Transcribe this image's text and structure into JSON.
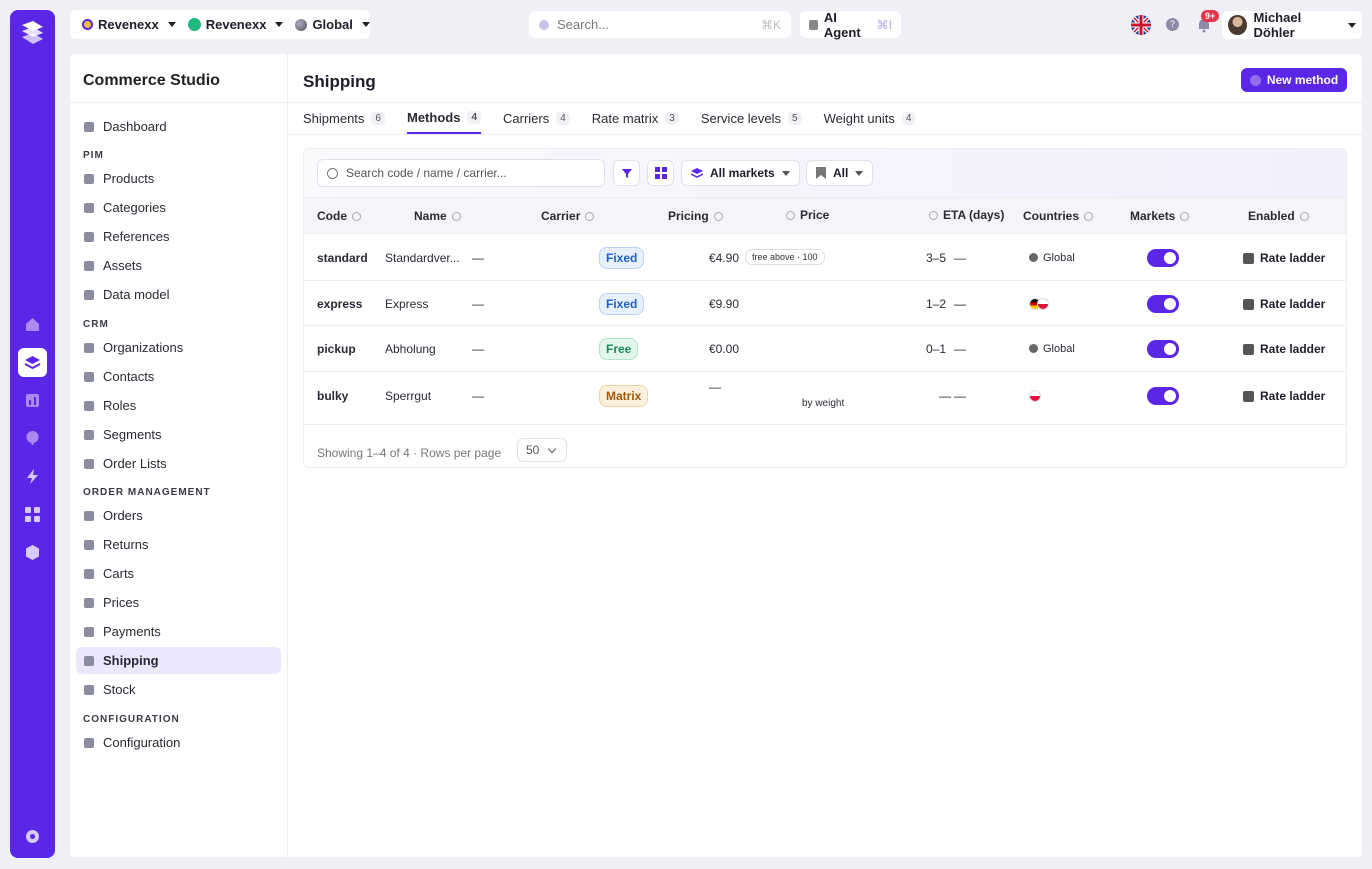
{
  "topbar": {
    "org1": "Revenexx",
    "org2": "Revenexx",
    "market": "Global",
    "search_placeholder": "Search...",
    "search_shortcut": "⌘K",
    "ai_label": "AI Agent",
    "ai_shortcut": "⌘I",
    "notifications": "9+",
    "user_name": "Michael Döhler"
  },
  "sidebar": {
    "title": "Commerce Studio",
    "top": [
      {
        "label": "Dashboard"
      }
    ],
    "sections": [
      {
        "title": "PIM",
        "items": [
          "Products",
          "Categories",
          "References",
          "Assets",
          "Data model"
        ]
      },
      {
        "title": "CRM",
        "items": [
          "Organizations",
          "Contacts",
          "Roles",
          "Segments",
          "Order Lists"
        ]
      },
      {
        "title": "ORDER MANAGEMENT",
        "items": [
          "Orders",
          "Returns",
          "Carts",
          "Prices",
          "Payments",
          "Shipping",
          "Stock"
        ]
      },
      {
        "title": "CONFIGURATION",
        "items": [
          "Configuration"
        ]
      }
    ],
    "active": "Shipping"
  },
  "page": {
    "title": "Shipping",
    "new_button": "New method",
    "tabs": [
      {
        "label": "Shipments",
        "count": "6"
      },
      {
        "label": "Methods",
        "count": "4"
      },
      {
        "label": "Carriers",
        "count": "4"
      },
      {
        "label": "Rate matrix",
        "count": "3"
      },
      {
        "label": "Service levels",
        "count": "5"
      },
      {
        "label": "Weight units",
        "count": "4"
      }
    ],
    "active_tab": "Methods"
  },
  "filters": {
    "search_placeholder": "Search code / name / carrier...",
    "markets": "All markets",
    "status": "All"
  },
  "table": {
    "headers": {
      "code": "Code",
      "name": "Name",
      "carrier": "Carrier",
      "pricing": "Pricing",
      "price": "Price",
      "eta": "ETA (days)",
      "countries": "Countries",
      "markets": "Markets",
      "enabled": "Enabled"
    },
    "rows": [
      {
        "code": "standard",
        "name": "Standardver...",
        "carrier": "—",
        "pricing": "Fixed",
        "price": "€4.90",
        "price_note": "free above · 100",
        "eta": "3–5",
        "eta_extra": "—",
        "countries": "Global",
        "action": "Rate ladder"
      },
      {
        "code": "express",
        "name": "Express",
        "carrier": "—",
        "pricing": "Fixed",
        "price": "€9.90",
        "price_note": "",
        "eta": "1–2",
        "eta_extra": "—",
        "countries": "",
        "action": "Rate ladder"
      },
      {
        "code": "pickup",
        "name": "Abholung",
        "carrier": "—",
        "pricing": "Free",
        "price": "€0.00",
        "price_note": "",
        "eta": "0–1",
        "eta_extra": "—",
        "countries": "Global",
        "action": "Rate ladder"
      },
      {
        "code": "bulky",
        "name": "Sperrgut",
        "carrier": "—",
        "pricing": "Matrix",
        "price": "—",
        "price_note": "by weight",
        "eta": "—",
        "eta_extra": "—",
        "countries": "",
        "action": "Rate ladder"
      }
    ],
    "footer": "Showing 1–4 of 4  ·  Rows per page",
    "rows_per_page": "50"
  }
}
